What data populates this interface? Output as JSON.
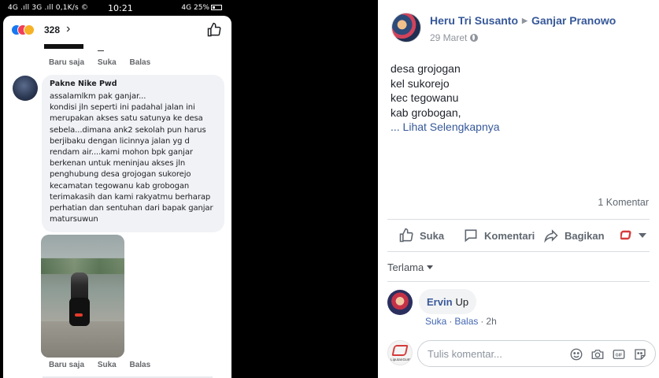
{
  "phone": {
    "statusbar": {
      "left": "4G .ıll 3G .ıll 0,1K/s ©",
      "time": "10:21",
      "right": "4G 25%"
    },
    "reactions": {
      "count": "328"
    },
    "prev_comment_meta": {
      "time": "Baru saja",
      "like": "Suka",
      "reply": "Balas"
    },
    "comment": {
      "author": "Pakne Nike Pwd",
      "text": "assalamlkm pak ganjar...\nkondisi jln seperti ini padahal jalan ini\nmerupakan akses satu satunya ke desa\nsebela...dimana ank2 sekolah pun harus\nberjibaku dengan licinnya jalan yg d\nrendam air....kami mohon bpk ganjar\nberkenan untuk meninjau akses jln\npenghubung desa grojogan sukorejo\nkecamatan tegowanu kab grobogan\nterimakasih dan kami rakyatmu berharap\nperhatian dan sentuhan dari bapak ganjar\nmatursuwun"
    },
    "video_meta": {
      "time": "Baru saja",
      "like": "Suka",
      "reply": "Balas"
    }
  },
  "post": {
    "author": "Heru Tri Susanto",
    "target": "Ganjar Pranowo",
    "date": "29 Maret",
    "body_lines": [
      "desa grojogan",
      "kel sukorejo",
      "kec tegowanu",
      "kab grobogan,"
    ],
    "see_more": "... Lihat Selengkapnya",
    "comment_count": "1 Komentar",
    "actions": {
      "like": "Suka",
      "comment": "Komentari",
      "share": "Bagikan"
    },
    "sort_label": "Terlama",
    "comment": {
      "author": "Ervin",
      "text": "Up",
      "like": "Suka",
      "reply": "Balas",
      "time": "2h"
    },
    "composer": {
      "placeholder": "Tulis komentar...",
      "page_logo_text": "LiputanGuMl"
    }
  },
  "colors": {
    "link": "#365899",
    "like_blue": "#1877f2",
    "love_red": "#f33e58",
    "wow_yellow": "#f7b125",
    "muted": "#606770"
  }
}
